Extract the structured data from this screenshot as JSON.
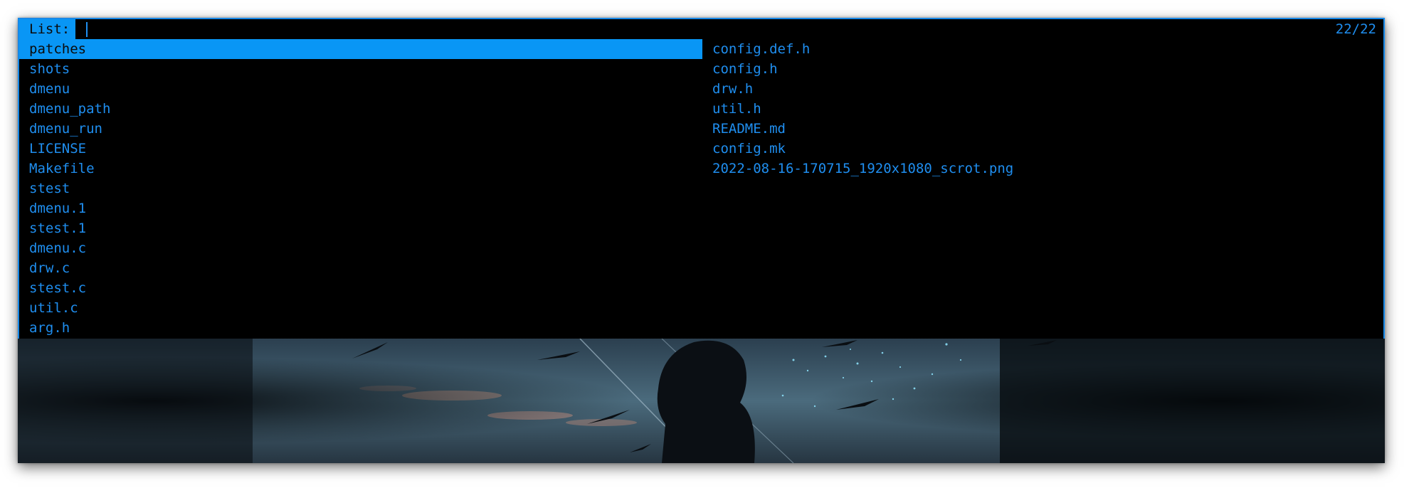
{
  "menu": {
    "prompt": "List:",
    "input_value": "",
    "count": "22/22",
    "selected_index": 0,
    "left_items": [
      "patches",
      "shots",
      "dmenu",
      "dmenu_path",
      "dmenu_run",
      "LICENSE",
      "Makefile",
      "stest",
      "dmenu.1",
      "stest.1",
      "dmenu.c",
      "drw.c",
      "stest.c",
      "util.c",
      "arg.h"
    ],
    "right_items": [
      "config.def.h",
      "config.h",
      "drw.h",
      "util.h",
      "README.md",
      "config.mk",
      "2022-08-16-170715_1920x1080_scrot.png"
    ]
  },
  "colors": {
    "accent": "#0996f5",
    "text": "#1f8eef",
    "background": "#000000",
    "border": "#1688e8"
  }
}
